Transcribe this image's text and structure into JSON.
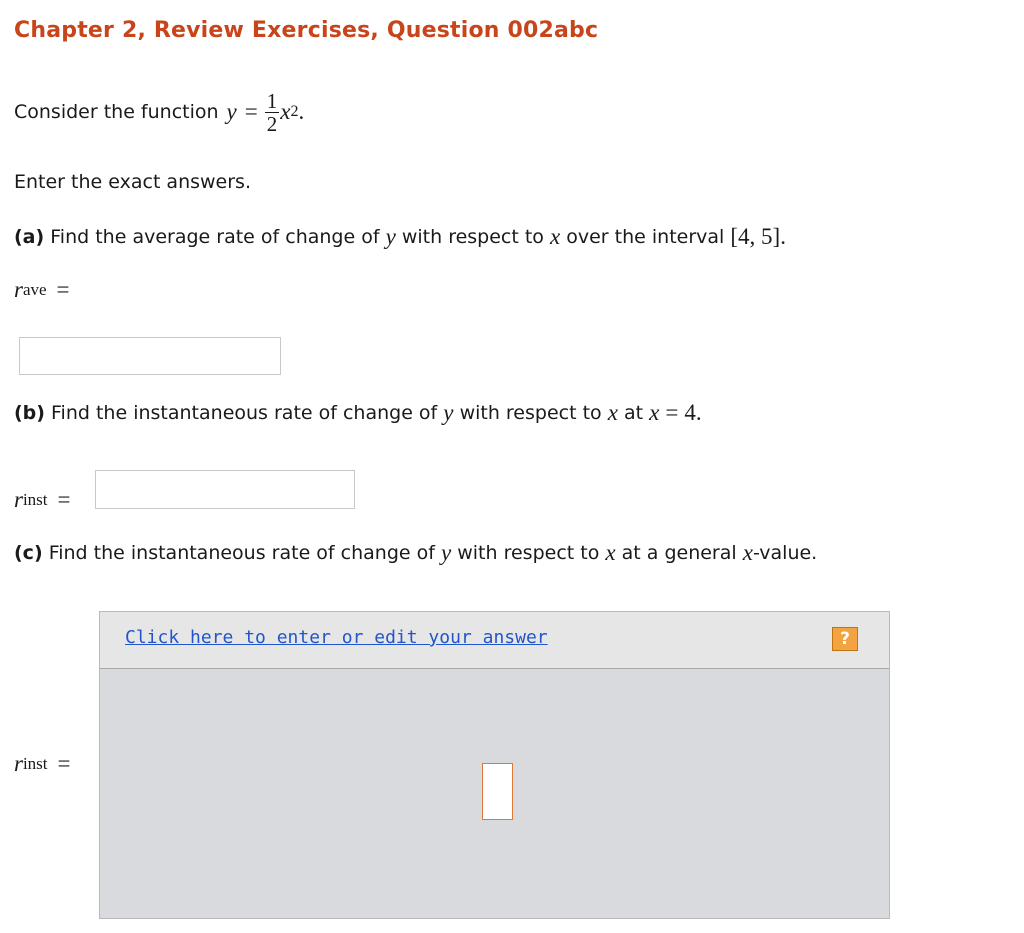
{
  "header": {
    "title": "Chapter 2, Review Exercises, Question 002abc"
  },
  "intro": {
    "consider_text": "Consider the function",
    "func_lhs": "y",
    "equals": "=",
    "frac_num": "1",
    "frac_den": "2",
    "func_var": "x",
    "func_exp": "2",
    "period": ".",
    "instruction": "Enter the exact answers."
  },
  "part_a": {
    "label": "(a)",
    "text_1": "Find the average rate of change of",
    "var_y": "y",
    "text_2": "with respect to",
    "var_x": "x",
    "text_3": "over the interval",
    "interval": "[4, 5]",
    "end": ".",
    "answer_var": "r",
    "answer_sub": "ave",
    "answer_eq": "=",
    "answer_value": ""
  },
  "part_b": {
    "label": "(b)",
    "text_1": "Find the instantaneous rate of change of",
    "var_y": "y",
    "text_2": "with respect to",
    "var_x": "x",
    "text_3": "at",
    "cond_var": "x",
    "cond_eq": "=",
    "cond_val": "4.",
    "answer_var": "r",
    "answer_sub": "inst",
    "answer_eq": "=",
    "answer_value": ""
  },
  "part_c": {
    "label": "(c)",
    "text_1": "Find the instantaneous rate of change of",
    "var_y": "y",
    "text_2": "with respect to",
    "var_x": "x",
    "text_3": "at a general",
    "gen_var": "x",
    "text_4": "-value.",
    "answer_var": "r",
    "answer_sub": "inst",
    "answer_eq": "="
  },
  "editor": {
    "link_text": "Click here to enter or edit your answer",
    "help_label": "?"
  },
  "colors": {
    "title": "#c8451b",
    "link": "#2255cc",
    "help_button": "#f3a440",
    "panel_bg": "#d8dadd",
    "entry_border": "#e0783a"
  }
}
